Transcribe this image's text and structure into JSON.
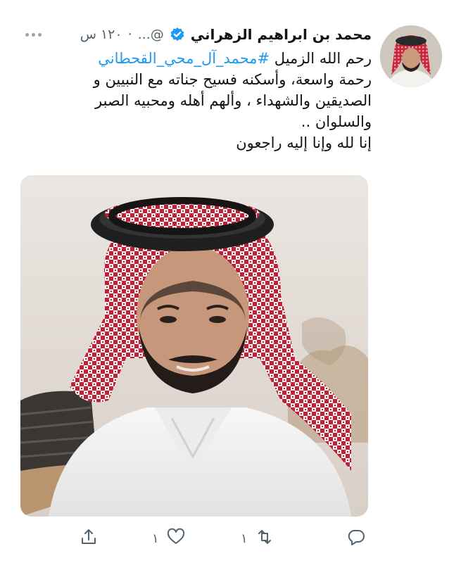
{
  "tweet": {
    "author": {
      "display_name": "محمد بن ابراهيم الزهراني",
      "handle": "...@",
      "timestamp": "١٢٠ س",
      "verified": true
    },
    "text": {
      "line1_prefix": "رحم الله الزميل ",
      "hashtag": "#محمد_آل_محي_القحطاني",
      "line2": "رحمة واسعة، وأسكنه فسيح جناته مع النبيين و",
      "line3": "الصديقين والشهداء ، وألهم أهله ومحبيه الصبر",
      "line4": "والسلوان ..",
      "line5": "إنا لله وإنا إليه راجعون"
    },
    "actions": {
      "reply_icon": "reply-icon",
      "retweet_count": "١",
      "like_count": "١",
      "share_icon": "share-icon"
    },
    "colors": {
      "accent": "#1d9bf0",
      "secondary_text": "#536471",
      "primary_text": "#0f1419"
    }
  }
}
